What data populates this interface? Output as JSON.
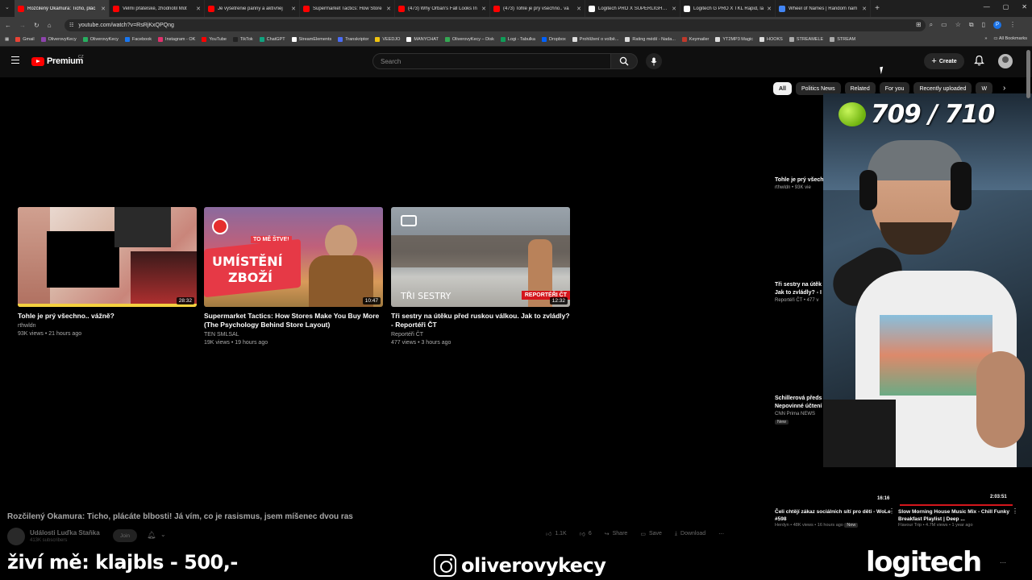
{
  "browser": {
    "tabs": [
      {
        "title": "Rozčilený Okamura: Ticho, plác",
        "active": true,
        "color": "#ff0000"
      },
      {
        "title": "Velmi přátelské, zhodnotil Mot",
        "active": false,
        "color": "#ff0000"
      },
      {
        "title": "Je vyšetrenie panny a aktívnej",
        "active": false,
        "color": "#ff0000"
      },
      {
        "title": "Supermarket Tactics: How Store",
        "active": false,
        "color": "#ff0000"
      },
      {
        "title": "(473) Why Orban's Fall Looks In",
        "active": false,
        "color": "#ff0000"
      },
      {
        "title": "(473) Tohle je prý všechno.. vá",
        "active": false,
        "color": "#ff0000"
      },
      {
        "title": "Logitech PRO X SUPERLIGHT 2",
        "active": false,
        "color": "#ffffff"
      },
      {
        "title": "Logitech G PRO X TKL Rapid, la",
        "active": false,
        "color": "#ffffff"
      },
      {
        "title": "Wheel of Names | Random nam",
        "active": false,
        "color": "#4285f4"
      }
    ],
    "url": "youtube.com/watch?v=RsRjKxQPQng",
    "profile_initial": "P",
    "bookmarks": [
      {
        "label": "Gmail",
        "color": "#ea4335"
      },
      {
        "label": "OliverovyKecy",
        "color": "#8e44ad"
      },
      {
        "label": "OliverovyKecy",
        "color": "#27ae60"
      },
      {
        "label": "Facebook",
        "color": "#1877f2"
      },
      {
        "label": "Instagram - OK",
        "color": "#e1306c"
      },
      {
        "label": "YouTube",
        "color": "#ff0000"
      },
      {
        "label": "TikTok",
        "color": "#222222"
      },
      {
        "label": "ChatGPT",
        "color": "#10a37f"
      },
      {
        "label": "StreamElements",
        "color": "#ffffff"
      },
      {
        "label": "Transkriptor",
        "color": "#4a6cf7"
      },
      {
        "label": "VEEDJO",
        "color": "#f1c40f"
      },
      {
        "label": "MANYCHAT",
        "color": "#ffffff"
      },
      {
        "label": "OliverovyKecy – Disk",
        "color": "#34a853"
      },
      {
        "label": "Logi - Tabulka",
        "color": "#0f9d58"
      },
      {
        "label": "Dropbox",
        "color": "#0061ff"
      },
      {
        "label": "Prohlížení o volbě...",
        "color": "#dddddd"
      },
      {
        "label": "Rating médií - Nada...",
        "color": "#dddddd"
      },
      {
        "label": "Keymailer",
        "color": "#c0392b"
      },
      {
        "label": "YT2MP3 Magic",
        "color": "#dddddd"
      },
      {
        "label": "HOOKS",
        "color": "#dddddd"
      },
      {
        "label": "STREAMELE",
        "color": "#aaaaaa"
      },
      {
        "label": "STREAM",
        "color": "#aaaaaa"
      }
    ],
    "all_bookmarks": "All Bookmarks"
  },
  "youtube": {
    "logo_text": "Premium",
    "region": "CZ",
    "search_placeholder": "Search",
    "create_label": "Create"
  },
  "end_screen": [
    {
      "title": "Tohle je prý všechno.. vážně?",
      "channel": "rthwldn",
      "meta": "93K views • 21 hours ago",
      "duration": "28:32"
    },
    {
      "title": "Supermarket Tactics: How Stores Make You Buy More (The Psychology Behind Store Layout)",
      "channel": "TEN SMLSAL",
      "meta": "19K views • 19 hours ago",
      "duration": "10:47",
      "overlay_line1": "TO MĚ ŠTVE!",
      "overlay_line2": "UMÍSTĚNÍ",
      "overlay_line3": "ZBOŽÍ"
    },
    {
      "title": "Tři sestry na útěku před ruskou válkou. Jak to zvládly? - Reportéři ČT",
      "channel": "Reportéři ČT",
      "meta": "477 views • 3 hours ago",
      "duration": "12:32",
      "overlay_line1": "TŘI SESTRY",
      "overlay_line2": "REPORTÉŘI ČT"
    }
  ],
  "video": {
    "title": "Rozčilený Okamura: Ticho, plácáte blbosti! Já vím, co je rasismus, jsem míšenec dvou ras",
    "channel": "Události Luďka Staňka",
    "subs": "413K subscribers",
    "join": "Join",
    "likes": "1.1K",
    "dislikes": "6",
    "share": "Share",
    "save": "Save",
    "download": "Download"
  },
  "sidebar": {
    "chips": [
      "All",
      "Politics News",
      "Related",
      "For you",
      "Recently uploaded",
      "W"
    ],
    "items": [
      {
        "title": "Tohle je prý všech",
        "meta": "rthwldn • 93K vie"
      },
      {
        "title1": "Tři sestry na útěk",
        "title2": "Jak to zvládly? - I",
        "meta": "Reportéři ČT • 477 v"
      },
      {
        "title1": "Schillerová předs",
        "title2": "Nepovinné účtení",
        "meta": "CNN Prima NEWS",
        "badge": "New"
      }
    ],
    "bottom": [
      {
        "title": "Čeli chtějí zákaz sociálních sítí pro děti - WoLe #598",
        "meta": "Herdyn • 48K views • 16 hours ago",
        "badge": "New",
        "duration": "16:16"
      },
      {
        "title": "Slow Morning House Music Mix - Chill Funky Breakfast Playlist | Deep ...",
        "meta": "Flavour Trip • 4.7M views • 1 year ago",
        "duration": "2:03:51"
      }
    ]
  },
  "overlay": {
    "counter": "709 / 710",
    "donation": "živí mě: klajbls - 500,-",
    "instagram": "oliverovykecy",
    "sponsor": "logitech"
  }
}
